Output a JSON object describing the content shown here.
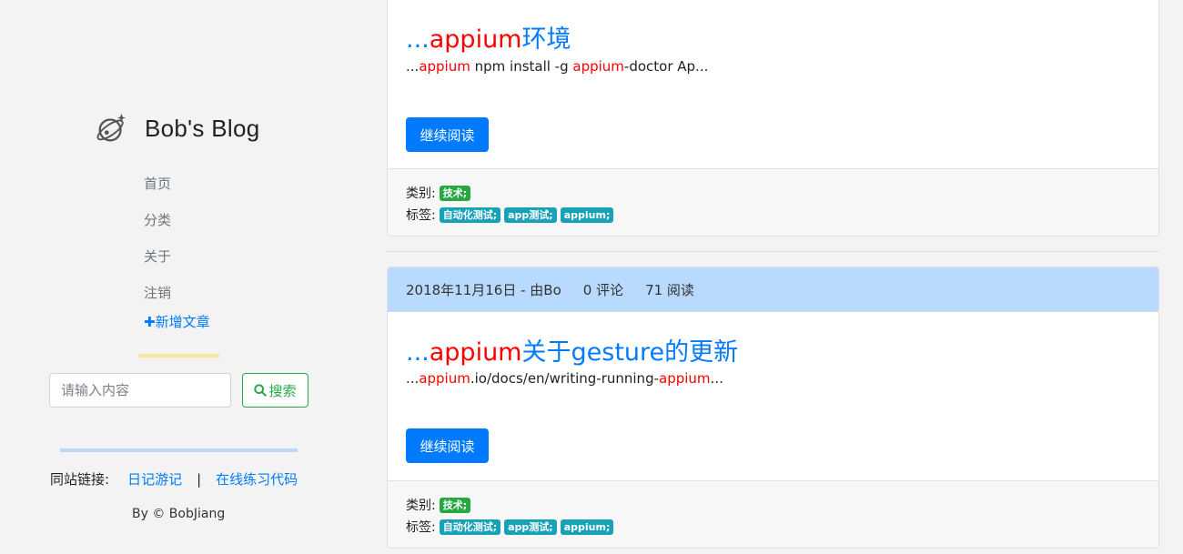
{
  "sidebar": {
    "blog_title": "Bob's Blog",
    "nav": [
      "首页",
      "分类",
      "关于",
      "注销"
    ],
    "new_post": "新增文章",
    "search_placeholder": "请输入内容",
    "search_button": "搜索",
    "links_label": "同站链接:",
    "link1": "日记游记",
    "separator": "|",
    "link2": "在线练习代码",
    "copyright": "By © BobJiang"
  },
  "posts": [
    {
      "title_prefix": "...",
      "title_highlight": "appium",
      "title_rest": "环境",
      "excerpt_prefix": "...",
      "excerpt_hl1": "appium",
      "excerpt_mid": " npm install -g ",
      "excerpt_hl2": "appium",
      "excerpt_rest": "-doctor Ap...",
      "read_more": "继续阅读",
      "category_label": "类别:",
      "category": "技术;",
      "tags_label": "标签:",
      "tags": [
        "自动化测试;",
        "app测试;",
        "appium;"
      ]
    },
    {
      "date": "2018年11月16日 - 由Bo",
      "comments": "0 评论",
      "views": "71 阅读",
      "title_prefix": "...",
      "title_highlight": "appium",
      "title_rest": "关于gesture的更新",
      "excerpt_prefix": "...",
      "excerpt_hl1": "appium",
      "excerpt_mid": ".io/docs/en/writing-running-",
      "excerpt_hl2": "appium",
      "excerpt_rest": "...",
      "read_more": "继续阅读",
      "category_label": "类别:",
      "category": "技术;",
      "tags_label": "标签:",
      "tags": [
        "自动化测试;",
        "app测试;",
        "appium;"
      ]
    }
  ],
  "colors": {
    "accent": "#007bff",
    "highlight": "#ff0000",
    "category_badge": "#28a745",
    "tag_badge": "#17a2b8",
    "header_bg": "#b8daff"
  },
  "icons": {
    "logo": "planet-icon",
    "search": "search-icon",
    "plus": "plus-icon"
  }
}
